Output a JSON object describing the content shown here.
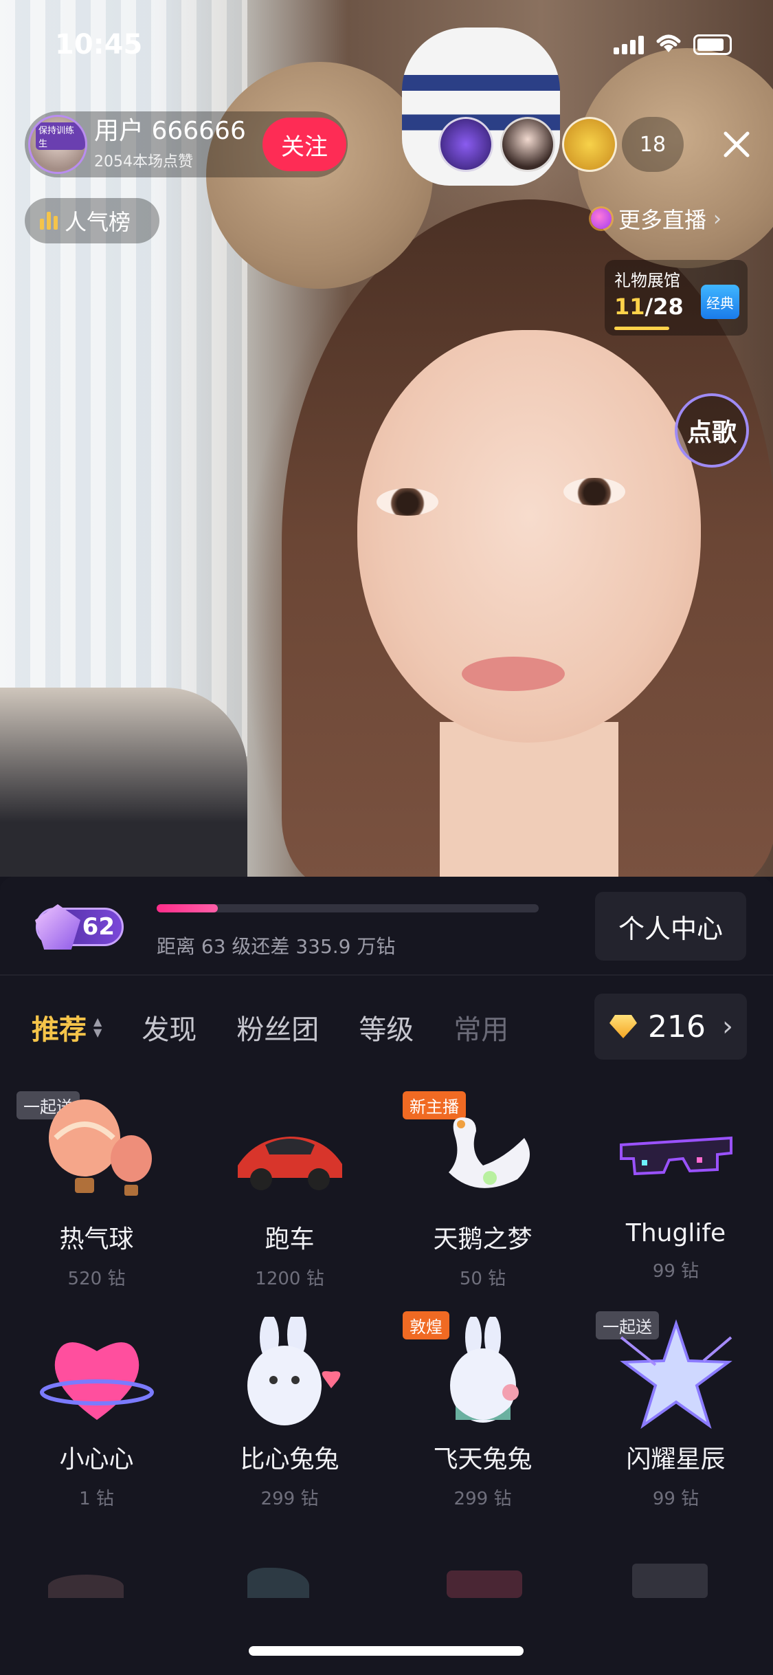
{
  "status_bar": {
    "time": "10:45"
  },
  "host": {
    "avatar_tag": "保持训练生",
    "name": "用户 666666",
    "likes": "2054本场点赞",
    "follow_label": "关注"
  },
  "viewers": {
    "count": "18"
  },
  "rank_label": "人气榜",
  "more_live_label": "更多直播",
  "gift_hall": {
    "title": "礼物展馆",
    "current": "11",
    "total": "/28",
    "badge": "经典"
  },
  "song_label": "点歌",
  "level": {
    "value": "62",
    "progress_fraction": 0.16,
    "progress_text": "距离 63 级还差 335.9 万钻",
    "personal_center_label": "个人中心"
  },
  "tabs": [
    {
      "label": "推荐"
    },
    {
      "label": "发现"
    },
    {
      "label": "粉丝团"
    },
    {
      "label": "等级"
    },
    {
      "label": "常用"
    }
  ],
  "balance": {
    "amount": "216"
  },
  "gifts": [
    {
      "name": "热气球",
      "price": "520 钻",
      "tag": "一起送"
    },
    {
      "name": "跑车",
      "price": "1200 钻",
      "tag": ""
    },
    {
      "name": "天鹅之梦",
      "price": "50 钻",
      "tag": "新主播"
    },
    {
      "name": "Thuglife",
      "price": "99 钻",
      "tag": ""
    },
    {
      "name": "小心心",
      "price": "1 钻",
      "tag": ""
    },
    {
      "name": "比心兔兔",
      "price": "299 钻",
      "tag": ""
    },
    {
      "name": "飞天兔兔",
      "price": "299 钻",
      "tag": "敦煌"
    },
    {
      "name": "闪耀星辰",
      "price": "99 钻",
      "tag": "一起送"
    }
  ]
}
